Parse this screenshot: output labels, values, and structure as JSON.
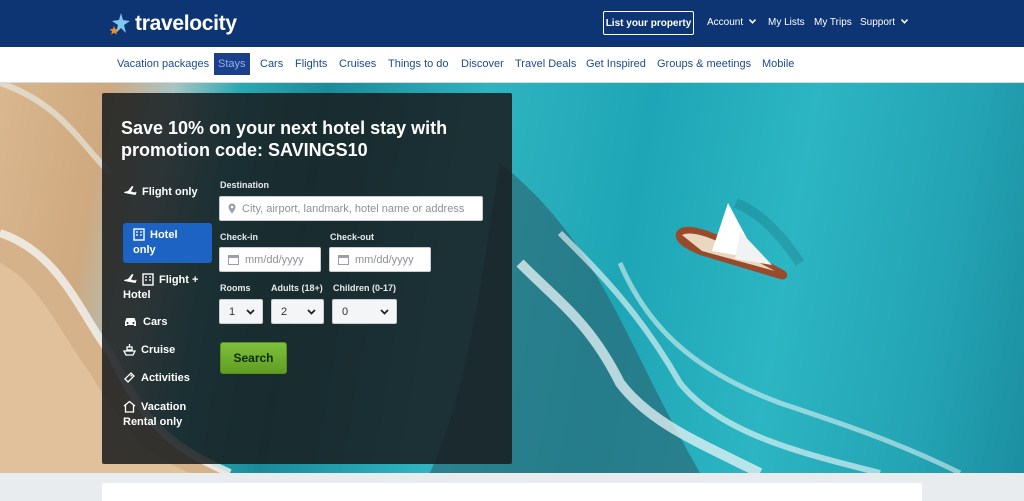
{
  "header": {
    "logo_text": "travelocity",
    "list_property": "List your property",
    "links": [
      "Account",
      "My Lists",
      "My Trips",
      "Support"
    ]
  },
  "nav": {
    "items": [
      "Vacation packages",
      "Stays",
      "Cars",
      "Flights",
      "Cruises",
      "Things to do",
      "Discover",
      "Travel Deals",
      "Get Inspired",
      "Groups & meetings",
      "Mobile"
    ],
    "active": "Stays"
  },
  "search": {
    "title": "Save 10% on your next hotel stay with promotion code: SAVINGS10",
    "types": [
      "Flight only",
      "Hotel only",
      "Flight + Hotel",
      "Cars",
      "Cruise",
      "Activities",
      "Vacation Rental only"
    ],
    "active_type": "Hotel only",
    "destination_label": "Destination",
    "destination_placeholder": "City, airport, landmark, hotel name or address",
    "checkin_label": "Check-in",
    "checkin_placeholder": "mm/dd/yyyy",
    "checkout_label": "Check-out",
    "checkout_placeholder": "mm/dd/yyyy",
    "rooms_label": "Rooms",
    "rooms_value": "1",
    "adults_label": "Adults (18+)",
    "adults_value": "2",
    "children_label": "Children (0-17)",
    "children_value": "0",
    "search_button": "Search"
  },
  "colors": {
    "header_bg": "#0e3573",
    "active_tab": "#1b3f8b",
    "active_type": "#1c63c4",
    "search_button": "#6aac2b"
  }
}
